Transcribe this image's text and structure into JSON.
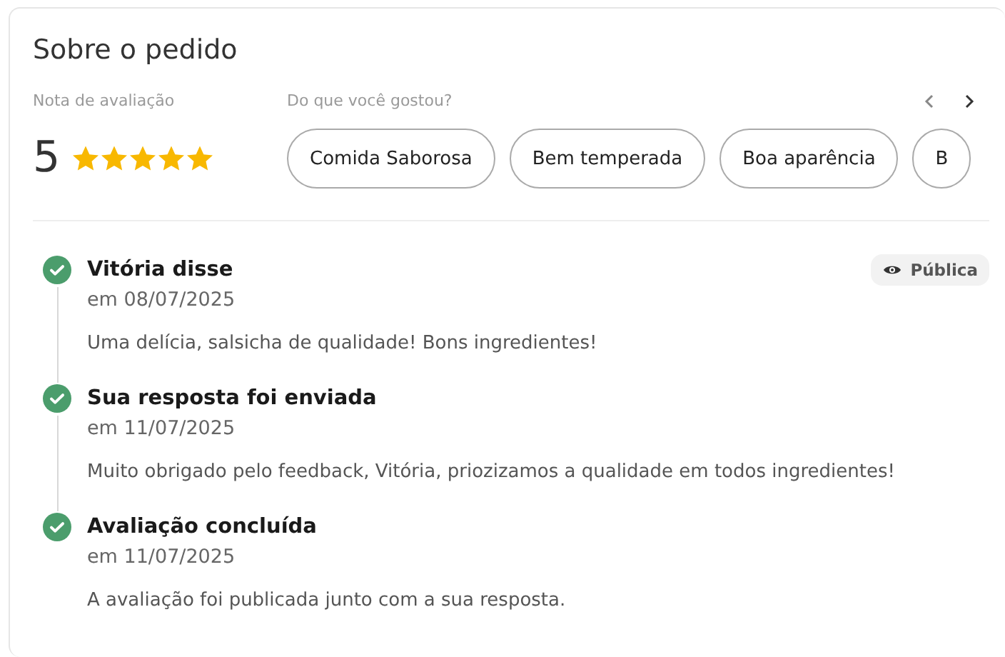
{
  "title": "Sobre o pedido",
  "rating": {
    "label": "Nota de avaliação",
    "score": "5",
    "stars": 5
  },
  "likes": {
    "label": "Do que você gostou?",
    "chips": [
      "Comida Saborosa",
      "Bem temperada",
      "Boa aparência",
      "B"
    ]
  },
  "timeline": [
    {
      "title": "Vitória disse",
      "date": "em 08/07/2025",
      "text": "Uma delícia, salsicha de qualidade! Bons ingredientes!",
      "badge": "Pública"
    },
    {
      "title": "Sua resposta foi enviada",
      "date": "em 11/07/2025",
      "text": "Muito obrigado pelo feedback, Vitória, priozizamos a qualidade em todos ingredientes!"
    },
    {
      "title": "Avaliação concluída",
      "date": "em 11/07/2025",
      "text": "A avaliação foi publicada junto com a sua resposta."
    }
  ]
}
